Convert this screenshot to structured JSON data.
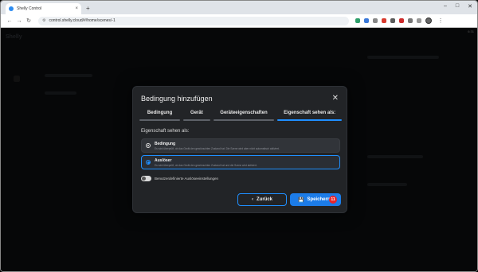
{
  "browser": {
    "tab_title": "Shelly Control",
    "tab_close": "×",
    "new_tab": "+",
    "url": "control.shelly.cloud/#/home/scenes/-1",
    "window_controls": {
      "minimize": "–",
      "maximize": "□",
      "close": "✕"
    }
  },
  "background": {
    "logo": "Shelly",
    "time": "6:31"
  },
  "modal": {
    "title": "Bedingung hinzufügen",
    "close": "✕",
    "steps": [
      {
        "label": "Bedingung",
        "active": false
      },
      {
        "label": "Gerät",
        "active": false
      },
      {
        "label": "Geräteeigenschaften",
        "active": false
      },
      {
        "label": "Eigenschaft sehen als:",
        "active": true
      }
    ],
    "section_label": "Eigenschaft sehen als:",
    "options": [
      {
        "title": "Bedingung",
        "description": "Es wird überprüft, ob das Gerät den gewünschten Zustand hat. Die Szene wird aber nicht automatisch aktiviert.",
        "selected": false
      },
      {
        "title": "Auslöser",
        "description": "Es wird überprüft, ob das Gerät den gewünschten Zustand hat und die Szene wird aktiviert.",
        "selected": true
      }
    ],
    "toggle_label": "Benutzerdefinierte Auslöseeinstellungen",
    "back_label": "Zurück",
    "save_label": "Speichern",
    "save_badge": "11"
  },
  "colors": {
    "accent": "#1f8fff",
    "modal_bg": "#222427",
    "badge": "#e8242c"
  }
}
